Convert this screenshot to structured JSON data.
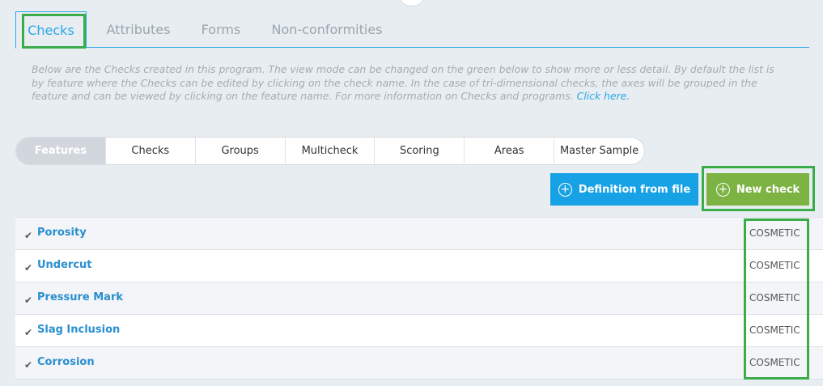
{
  "tabs": [
    {
      "label": "Checks",
      "active": true
    },
    {
      "label": "Attributes",
      "active": false
    },
    {
      "label": "Forms",
      "active": false
    },
    {
      "label": "Non-conformities",
      "active": false
    }
  ],
  "help": {
    "text": "Below are the Checks created in this program. The view mode can be changed on the green below to show more or less detail. By default the list is by feature where the Checks can be edited by clicking on the check name. In the case of tri-dimensional checks, the axes will be grouped in the feature and can be viewed by clicking on the feature name. For more information on Checks and programs.",
    "link": "Click here."
  },
  "view_modes": [
    "Features",
    "Checks",
    "Groups",
    "Multicheck",
    "Scoring",
    "Areas",
    "Master Sample"
  ],
  "buttons": {
    "definition_label": "Definition from file",
    "new_check_label": "New check",
    "plus_glyph": "+"
  },
  "rows": [
    {
      "name": "Porosity",
      "type": "COSMETIC"
    },
    {
      "name": "Undercut",
      "type": "COSMETIC"
    },
    {
      "name": "Pressure Mark",
      "type": "COSMETIC"
    },
    {
      "name": "Slag Inclusion",
      "type": "COSMETIC"
    },
    {
      "name": "Corrosion",
      "type": "COSMETIC"
    }
  ],
  "icons": {
    "row_check": "checkmark-icon",
    "plus": "plus-circle-icon"
  },
  "colors": {
    "accent": "#29a7e8",
    "primary_button": "#17a2e6",
    "new_button": "#7cb342",
    "highlight": "#3aad4a",
    "link": "#2a8fd0"
  }
}
